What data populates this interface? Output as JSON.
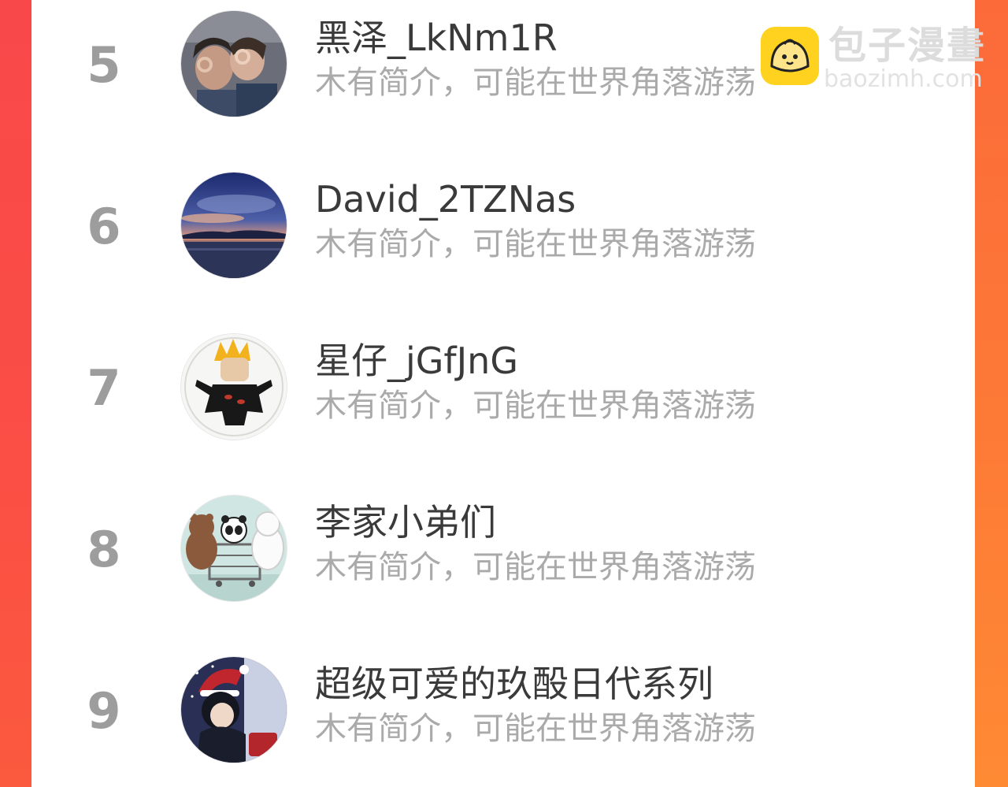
{
  "watermark": {
    "title": "包子漫畫",
    "url": "baozimh.com",
    "logo_icon": "bun-mascot-icon",
    "logo_color": "#ffd21f"
  },
  "ranking": [
    {
      "rank": "5",
      "name": "黑泽_LkNm1R",
      "bio": "木有简介，可能在世界角落游荡",
      "avatar_icon": "avatar-two-people-ok-gesture"
    },
    {
      "rank": "6",
      "name": "David_2TZNas",
      "bio": "木有简介，可能在世界角落游荡",
      "avatar_icon": "avatar-sunset-sea"
    },
    {
      "rank": "7",
      "name": "星仔_jGfJnG",
      "bio": "木有简介，可能在世界角落游荡",
      "avatar_icon": "avatar-anime-character"
    },
    {
      "rank": "8",
      "name": "李家小弟们",
      "bio": "木有简介，可能在世界角落游荡",
      "avatar_icon": "avatar-three-bears"
    },
    {
      "rank": "9",
      "name": "超级可爱的玖酘日代系列",
      "bio": "木有简介，可能在世界角落游荡",
      "avatar_icon": "avatar-anime-boy-christmas"
    }
  ],
  "colors": {
    "side_left": "#f9484a",
    "side_right": "#fd7a36",
    "rank_text": "#9d9d9d",
    "name_text": "#3a3a3a",
    "bio_text": "#aaaaaa"
  }
}
